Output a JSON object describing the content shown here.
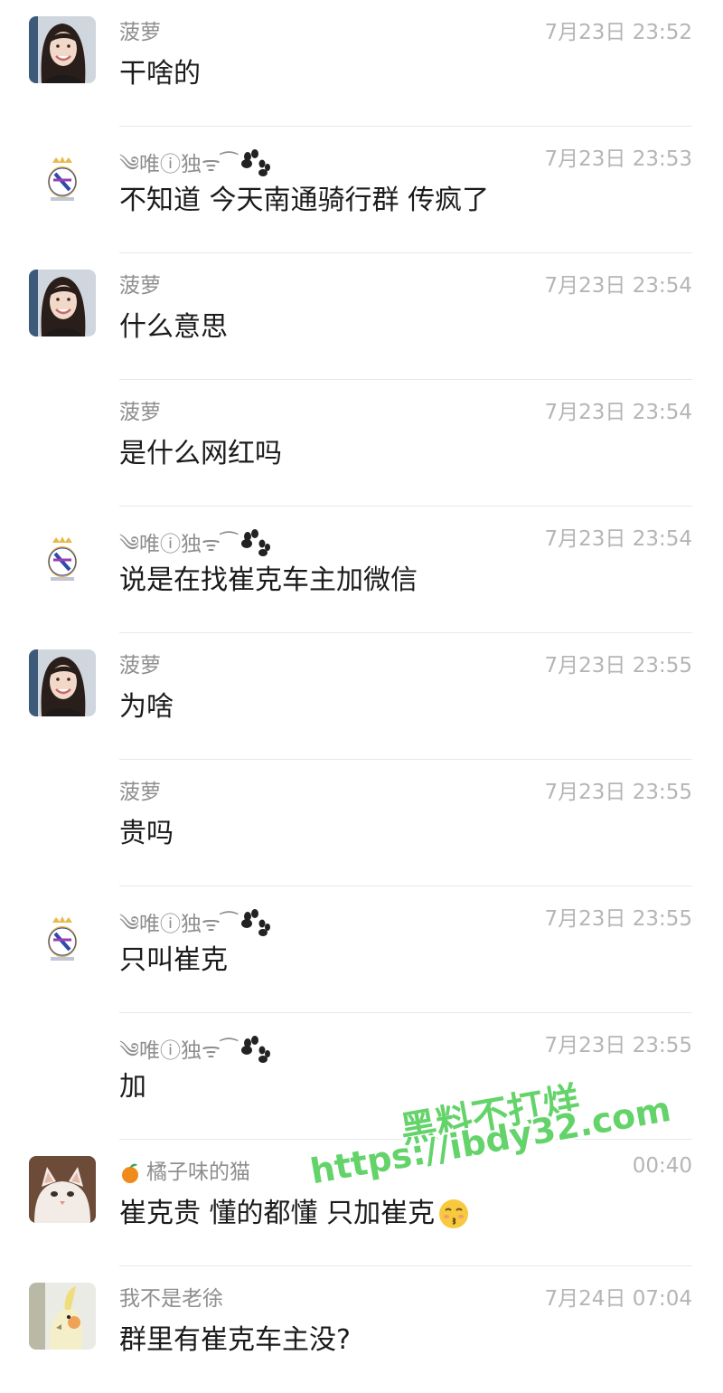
{
  "messages": [
    {
      "sender": "菠萝",
      "time": "7月23日 23:52",
      "text": "干啥的",
      "avatar": "girl-avatar",
      "show_avatar": true
    },
    {
      "sender": "༄唯ⓘ独ᯤ⁀",
      "time": "7月23日 23:53",
      "text": "不知道  今天南通骑行群 传疯了",
      "avatar": "real-madrid-badge-icon",
      "show_avatar": true,
      "paw": true
    },
    {
      "sender": "菠萝",
      "time": "7月23日 23:54",
      "text": "什么意思",
      "avatar": "girl-avatar",
      "show_avatar": true
    },
    {
      "sender": "菠萝",
      "time": "7月23日 23:54",
      "text": "是什么网红吗",
      "show_avatar": false
    },
    {
      "sender": "༄唯ⓘ独ᯤ⁀",
      "time": "7月23日 23:54",
      "text": "说是在找崔克车主加微信",
      "avatar": "real-madrid-badge-icon",
      "show_avatar": true,
      "paw": true
    },
    {
      "sender": "菠萝",
      "time": "7月23日 23:55",
      "text": "为啥",
      "avatar": "girl-avatar",
      "show_avatar": true
    },
    {
      "sender": "菠萝",
      "time": "7月23日 23:55",
      "text": "贵吗",
      "show_avatar": false
    },
    {
      "sender": "༄唯ⓘ独ᯤ⁀",
      "time": "7月23日 23:55",
      "text": "只叫崔克",
      "avatar": "real-madrid-badge-icon",
      "show_avatar": true,
      "paw": true
    },
    {
      "sender": "༄唯ⓘ独ᯤ⁀",
      "time": "7月23日 23:55",
      "text": "加",
      "show_avatar": false,
      "paw": true
    },
    {
      "sender": "橘子味的猫",
      "time": "00:40",
      "text": "崔克贵 懂的都懂 只加崔克",
      "avatar": "cat-avatar",
      "show_avatar": true,
      "lead_icon": "orange-icon",
      "emoji": "kissing-face-emoji"
    },
    {
      "sender": "我不是老徐",
      "time": "7月24日 07:04",
      "text": "群里有崔克车主没?",
      "avatar": "cockatiel-avatar",
      "show_avatar": true
    }
  ],
  "watermark": {
    "line1": "黑料不打烊",
    "line2": "https://ibdy32.com"
  },
  "colors": {
    "name": "#8e8e8e",
    "time": "#b5b5b5",
    "text": "#1b1b1b",
    "divider": "#e8e8e8",
    "watermark": "#63d36a"
  }
}
